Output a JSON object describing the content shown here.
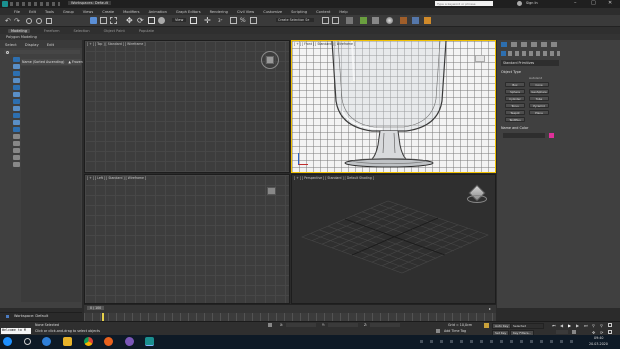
{
  "window": {
    "title": "Workspaces: Default",
    "sign_in": "Sign In",
    "search_placeholder": "Type a keyword or phrase"
  },
  "menu": [
    "File",
    "Edit",
    "Tools",
    "Group",
    "Views",
    "Create",
    "Modifiers",
    "Animation",
    "Graph Editors",
    "Rendering",
    "Civil View",
    "Customize",
    "Scripting",
    "Content",
    "Help"
  ],
  "toolbar": {
    "selection_set": "Create Selection Se",
    "view_label": "View"
  },
  "ribbon_tabs": [
    "Modeling",
    "Freeform",
    "Selection",
    "Object Paint",
    "Populate"
  ],
  "ribbon_sub": "Polygon Modeling",
  "explorer": {
    "menu": [
      "Select",
      "Display",
      "Edit"
    ],
    "header_name": "Name (Sorted Ascending)",
    "header_frozen": "▲ Frozen",
    "workspace": "Workspace: Default"
  },
  "viewports": {
    "top": "[ + ] [ Top ] [ Standard ] [ Wireframe ]",
    "front": "[ + ] [ Front ] [ Standard ] [ Wireframe ]",
    "left": "[ + ] [ Left ] [ Standard ] [ Wireframe ]",
    "perspective": "[ + ] [ Perspective ] [ Standard ] [ Default Shading ]"
  },
  "command_panel": {
    "dropdown": "Standard Primitives",
    "object_type_title": "Object Type",
    "autogrid": "AutoGrid",
    "buttons": [
      "Box",
      "Cone",
      "Sphere",
      "GeoSphere",
      "Cylinder",
      "Tube",
      "Torus",
      "Pyramid",
      "Teapot",
      "Plane",
      "TextPlus"
    ],
    "name_color_title": "Name and Color"
  },
  "timeline": {
    "frame": "0 / 100"
  },
  "status": {
    "script": "Welcome to M",
    "selection": "None Selected",
    "hint": "Click or click-and-drag to select objects",
    "x_label": "X:",
    "y_label": "Y:",
    "z_label": "Z:",
    "grid": "Grid = 10,0cm",
    "add_time_tag": "Add Time Tag",
    "auto_key": "Auto Key",
    "set_key": "Set Key",
    "selected": "Selected",
    "key_filters": "Key Filters..."
  },
  "taskbar": {
    "time": "09:40",
    "date": "20.03.2020"
  },
  "colors": {
    "accent": "#f0c000",
    "select_blue": "#2d6fb0",
    "swatch": "#e0309a"
  }
}
